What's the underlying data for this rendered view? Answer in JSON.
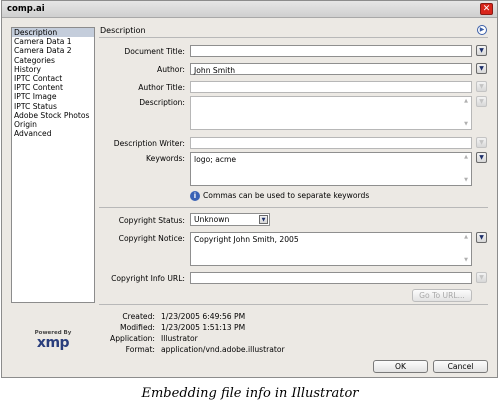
{
  "window": {
    "title": "comp.ai",
    "close_glyph": "✕"
  },
  "sidebar": {
    "items": [
      {
        "label": "Description",
        "active": true
      },
      {
        "label": "Camera Data 1"
      },
      {
        "label": "Camera Data 2"
      },
      {
        "label": "Categories"
      },
      {
        "label": "History"
      },
      {
        "label": "IPTC Contact"
      },
      {
        "label": "IPTC Content"
      },
      {
        "label": "IPTC Image"
      },
      {
        "label": "IPTC Status"
      },
      {
        "label": "Adobe Stock Photos"
      },
      {
        "label": "Origin"
      },
      {
        "label": "Advanced"
      }
    ]
  },
  "logo": {
    "powered_by": "Powered By",
    "name": "xmp"
  },
  "section": {
    "title": "Description"
  },
  "form": {
    "document_title": {
      "label": "Document Title:",
      "value": ""
    },
    "author": {
      "label": "Author:",
      "value": "John Smith"
    },
    "author_title": {
      "label": "Author Title:",
      "value": ""
    },
    "description": {
      "label": "Description:",
      "value": ""
    },
    "description_writer": {
      "label": "Description Writer:",
      "value": ""
    },
    "keywords": {
      "label": "Keywords:",
      "value": "logo; acme"
    },
    "keywords_hint": "Commas can be used to separate keywords",
    "copyright_status": {
      "label": "Copyright Status:",
      "value": "Unknown"
    },
    "copyright_notice": {
      "label": "Copyright Notice:",
      "value": "Copyright John Smith, 2005"
    },
    "copyright_url": {
      "label": "Copyright Info URL:",
      "value": ""
    },
    "go_to_url": "Go To URL..."
  },
  "metadata": {
    "created": {
      "label": "Created:",
      "value": "1/23/2005 6:49:56 PM"
    },
    "modified": {
      "label": "Modified:",
      "value": "1/23/2005 1:51:13 PM"
    },
    "application": {
      "label": "Application:",
      "value": "Illustrator"
    },
    "format": {
      "label": "Format:",
      "value": "application/vnd.adobe.illustrator"
    }
  },
  "buttons": {
    "ok": "OK",
    "cancel": "Cancel"
  },
  "icons": {
    "dropdown": "▼",
    "scroll_up": "▲",
    "scroll_down": "▼",
    "nav": "▶",
    "info": "i"
  },
  "caption": "Embedding file info in Illustrator"
}
